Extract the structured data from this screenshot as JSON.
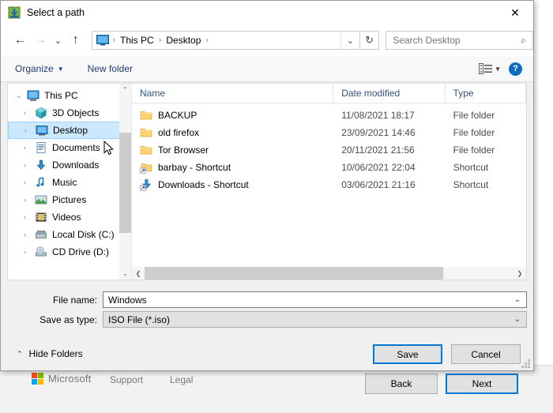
{
  "dialog": {
    "title": "Select a path",
    "title_icon": "save-arrow-icon",
    "close_icon": "✕"
  },
  "nav": {
    "back_icon": "←",
    "forward_icon": "→",
    "recent_icon": "⌄",
    "up_icon": "↑",
    "refresh_icon": "↻",
    "address_dropdown_icon": "⌄",
    "breadcrumbs": [
      {
        "label": "This PC"
      },
      {
        "label": "Desktop"
      }
    ],
    "separator": "›"
  },
  "search": {
    "placeholder": "Search Desktop",
    "value": "",
    "icon": "⌕"
  },
  "toolbar": {
    "organize_label": "Organize",
    "new_folder_label": "New folder",
    "caret": "▼",
    "help_label": "?"
  },
  "tree": {
    "items": [
      {
        "label": "This PC",
        "icon": "computer-icon",
        "twisty": "⌄",
        "level": 0,
        "selected": false
      },
      {
        "label": "3D Objects",
        "icon": "3d-objects-icon",
        "twisty": "›",
        "level": 1,
        "selected": false
      },
      {
        "label": "Desktop",
        "icon": "desktop-icon",
        "twisty": "›",
        "level": 1,
        "selected": true
      },
      {
        "label": "Documents",
        "icon": "documents-icon",
        "twisty": "›",
        "level": 1,
        "selected": false
      },
      {
        "label": "Downloads",
        "icon": "downloads-icon",
        "twisty": "›",
        "level": 1,
        "selected": false
      },
      {
        "label": "Music",
        "icon": "music-icon",
        "twisty": "›",
        "level": 1,
        "selected": false
      },
      {
        "label": "Pictures",
        "icon": "pictures-icon",
        "twisty": "›",
        "level": 1,
        "selected": false
      },
      {
        "label": "Videos",
        "icon": "videos-icon",
        "twisty": "›",
        "level": 1,
        "selected": false
      },
      {
        "label": "Local Disk (C:)",
        "icon": "drive-icon",
        "twisty": "›",
        "level": 1,
        "selected": false
      },
      {
        "label": "CD Drive (D:)",
        "icon": "cd-drive-icon",
        "twisty": "›",
        "level": 1,
        "selected": false
      }
    ],
    "scroll_up_icon": "⌃",
    "scroll_down_icon": "⌄"
  },
  "filelist": {
    "columns": [
      {
        "label": "Name"
      },
      {
        "label": "Date modified"
      },
      {
        "label": "Type"
      }
    ],
    "sort_indicator": "⌃",
    "rows": [
      {
        "name": "BACKUP",
        "date": "11/08/2021 18:17",
        "type": "File folder",
        "icon": "folder-icon"
      },
      {
        "name": "old firefox",
        "date": "23/09/2021 14:46",
        "type": "File folder",
        "icon": "folder-icon"
      },
      {
        "name": "Tor Browser",
        "date": "20/11/2021 21:56",
        "type": "File folder",
        "icon": "folder-icon"
      },
      {
        "name": "barbay - Shortcut",
        "date": "10/06/2021 22:04",
        "type": "Shortcut",
        "icon": "folder-shortcut-icon"
      },
      {
        "name": "Downloads - Shortcut",
        "date": "03/06/2021 21:16",
        "type": "Shortcut",
        "icon": "downloads-shortcut-icon"
      }
    ],
    "hscroll_left_icon": "❮",
    "hscroll_right_icon": "❯"
  },
  "form": {
    "filename_label": "File name:",
    "filename_value": "Windows",
    "savetype_label": "Save as type:",
    "savetype_value": "ISO File (*.iso)",
    "dropdown_icon": "⌄"
  },
  "footer": {
    "hide_folders_label": "Hide Folders",
    "hide_folders_caret": "⌃",
    "save_label": "Save",
    "cancel_label": "Cancel"
  },
  "backdrop": {
    "brand": "Microsoft",
    "support_label": "Support",
    "legal_label": "Legal",
    "back_label": "Back",
    "next_label": "Next"
  },
  "colors": {
    "accent": "#0078d7",
    "selection": "#cce8ff",
    "folder": "#ffd270",
    "link": "#1d3c73"
  }
}
